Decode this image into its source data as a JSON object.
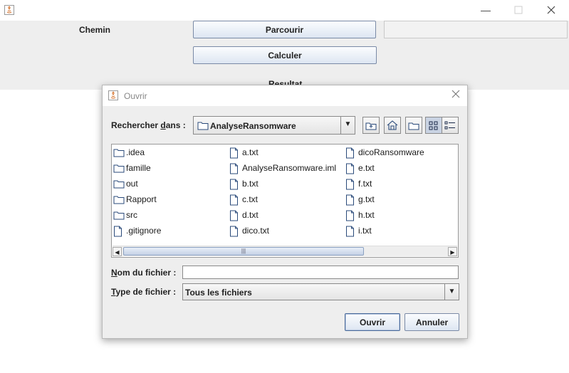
{
  "main": {
    "path_label": "Chemin",
    "browse_button": "Parcourir",
    "compute_button": "Calculer",
    "result_label": "Resultat",
    "path_value": ""
  },
  "dialog": {
    "title": "Ouvrir",
    "look_in_label_pre": "Rechercher ",
    "look_in_label_u": "d",
    "look_in_label_post": "ans :",
    "look_in_value": "AnalyseRansomware",
    "files": [
      [
        {
          "name": ".idea",
          "type": "folder"
        },
        {
          "name": "famille",
          "type": "folder"
        },
        {
          "name": "out",
          "type": "folder"
        },
        {
          "name": "Rapport",
          "type": "folder"
        },
        {
          "name": "src",
          "type": "folder"
        },
        {
          "name": ".gitignore",
          "type": "file"
        }
      ],
      [
        {
          "name": "a.txt",
          "type": "file"
        },
        {
          "name": "AnalyseRansomware.iml",
          "type": "file"
        },
        {
          "name": "b.txt",
          "type": "file"
        },
        {
          "name": "c.txt",
          "type": "file"
        },
        {
          "name": "d.txt",
          "type": "file"
        },
        {
          "name": "dico.txt",
          "type": "file"
        }
      ],
      [
        {
          "name": "dicoRansomware",
          "type": "file"
        },
        {
          "name": "e.txt",
          "type": "file"
        },
        {
          "name": "f.txt",
          "type": "file"
        },
        {
          "name": "g.txt",
          "type": "file"
        },
        {
          "name": "h.txt",
          "type": "file"
        },
        {
          "name": "i.txt",
          "type": "file"
        }
      ]
    ],
    "filename_label_u": "N",
    "filename_label_post": "om du fichier :",
    "filename_value": "",
    "filetype_label_u": "T",
    "filetype_label_post": "ype de fichier :",
    "filetype_value": "Tous les fichiers",
    "open_button": "Ouvrir",
    "cancel_button": "Annuler"
  },
  "icons": {
    "minimize": "minimize-icon",
    "maximize": "maximize-icon",
    "close": "close-icon"
  }
}
